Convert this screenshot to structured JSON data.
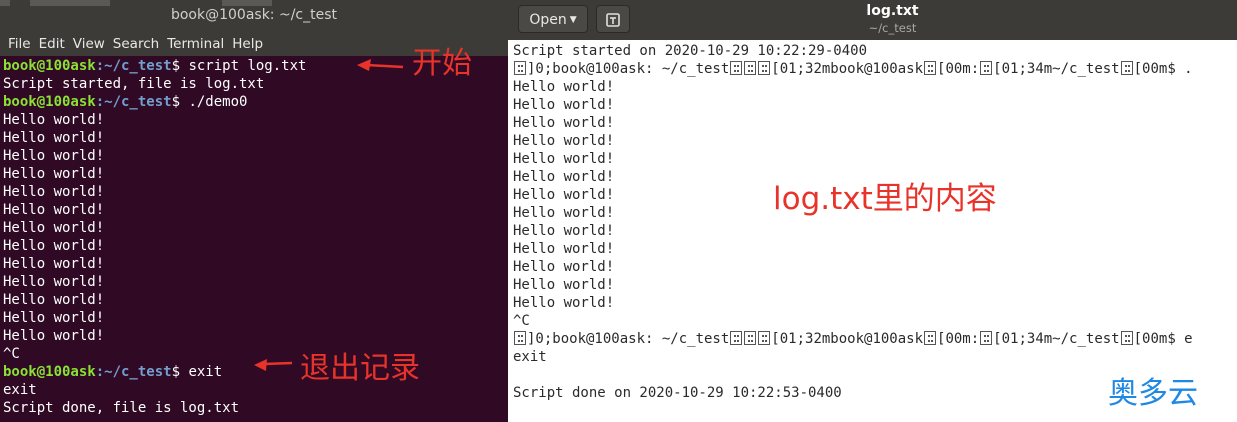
{
  "terminal": {
    "title": "book@100ask: ~/c_test",
    "menu": [
      "File",
      "Edit",
      "View",
      "Search",
      "Terminal",
      "Help"
    ],
    "lines": [
      {
        "user": "book@100ask",
        "path": ":~/c_test",
        "dollar": "$ ",
        "cmd": "script log.txt"
      },
      {
        "text": "Script started, file is log.txt"
      },
      {
        "user": "book@100ask",
        "path": ":~/c_test",
        "dollar": "$ ",
        "cmd": "./demo0"
      },
      {
        "text": "Hello world!"
      },
      {
        "text": "Hello world!"
      },
      {
        "text": "Hello world!"
      },
      {
        "text": "Hello world!"
      },
      {
        "text": "Hello world!"
      },
      {
        "text": "Hello world!"
      },
      {
        "text": "Hello world!"
      },
      {
        "text": "Hello world!"
      },
      {
        "text": "Hello world!"
      },
      {
        "text": "Hello world!"
      },
      {
        "text": "Hello world!"
      },
      {
        "text": "Hello world!"
      },
      {
        "text": "Hello world!"
      },
      {
        "text": "^C"
      },
      {
        "user": "book@100ask",
        "path": ":~/c_test",
        "dollar": "$ ",
        "cmd": "exit"
      },
      {
        "text": "exit"
      },
      {
        "text": "Script done, file is log.txt"
      }
    ]
  },
  "gedit": {
    "open_label": "Open",
    "doc_title": "log.txt",
    "doc_path": "~/c_test",
    "lines": [
      {
        "text": "Script started on 2020-10-29 10:22:29-0400"
      },
      {
        "segments": [
          "]0;book@100ask: ~/c_test",
          "",
          "[01;32mbook@100ask",
          "[00m:",
          "[01;34m~/c_test",
          "[00m$ ."
        ]
      },
      {
        "text": "Hello world!"
      },
      {
        "text": "Hello world!"
      },
      {
        "text": "Hello world!"
      },
      {
        "text": "Hello world!"
      },
      {
        "text": "Hello world!"
      },
      {
        "text": "Hello world!"
      },
      {
        "text": "Hello world!"
      },
      {
        "text": "Hello world!"
      },
      {
        "text": "Hello world!"
      },
      {
        "text": "Hello world!"
      },
      {
        "text": "Hello world!"
      },
      {
        "text": "Hello world!"
      },
      {
        "text": "Hello world!"
      },
      {
        "text": "^C"
      },
      {
        "segments": [
          "]0;book@100ask: ~/c_test",
          "",
          "[01;32mbook@100ask",
          "[00m:",
          "[01;34m~/c_test",
          "[00m$ e"
        ]
      },
      {
        "text": "exit"
      },
      {
        "text": ""
      },
      {
        "text": "Script done on 2020-10-29 10:22:53-0400"
      }
    ]
  },
  "annotations": {
    "start": "开始",
    "exit": "退出记录",
    "content": "log.txt里的内容"
  },
  "watermark": "奥多云",
  "colors": {
    "terminal_bg": "#300a24",
    "prompt_user": "#8ae234",
    "prompt_path": "#729fcf",
    "annotation": "#e8332a",
    "watermark": "#1e88e5"
  }
}
